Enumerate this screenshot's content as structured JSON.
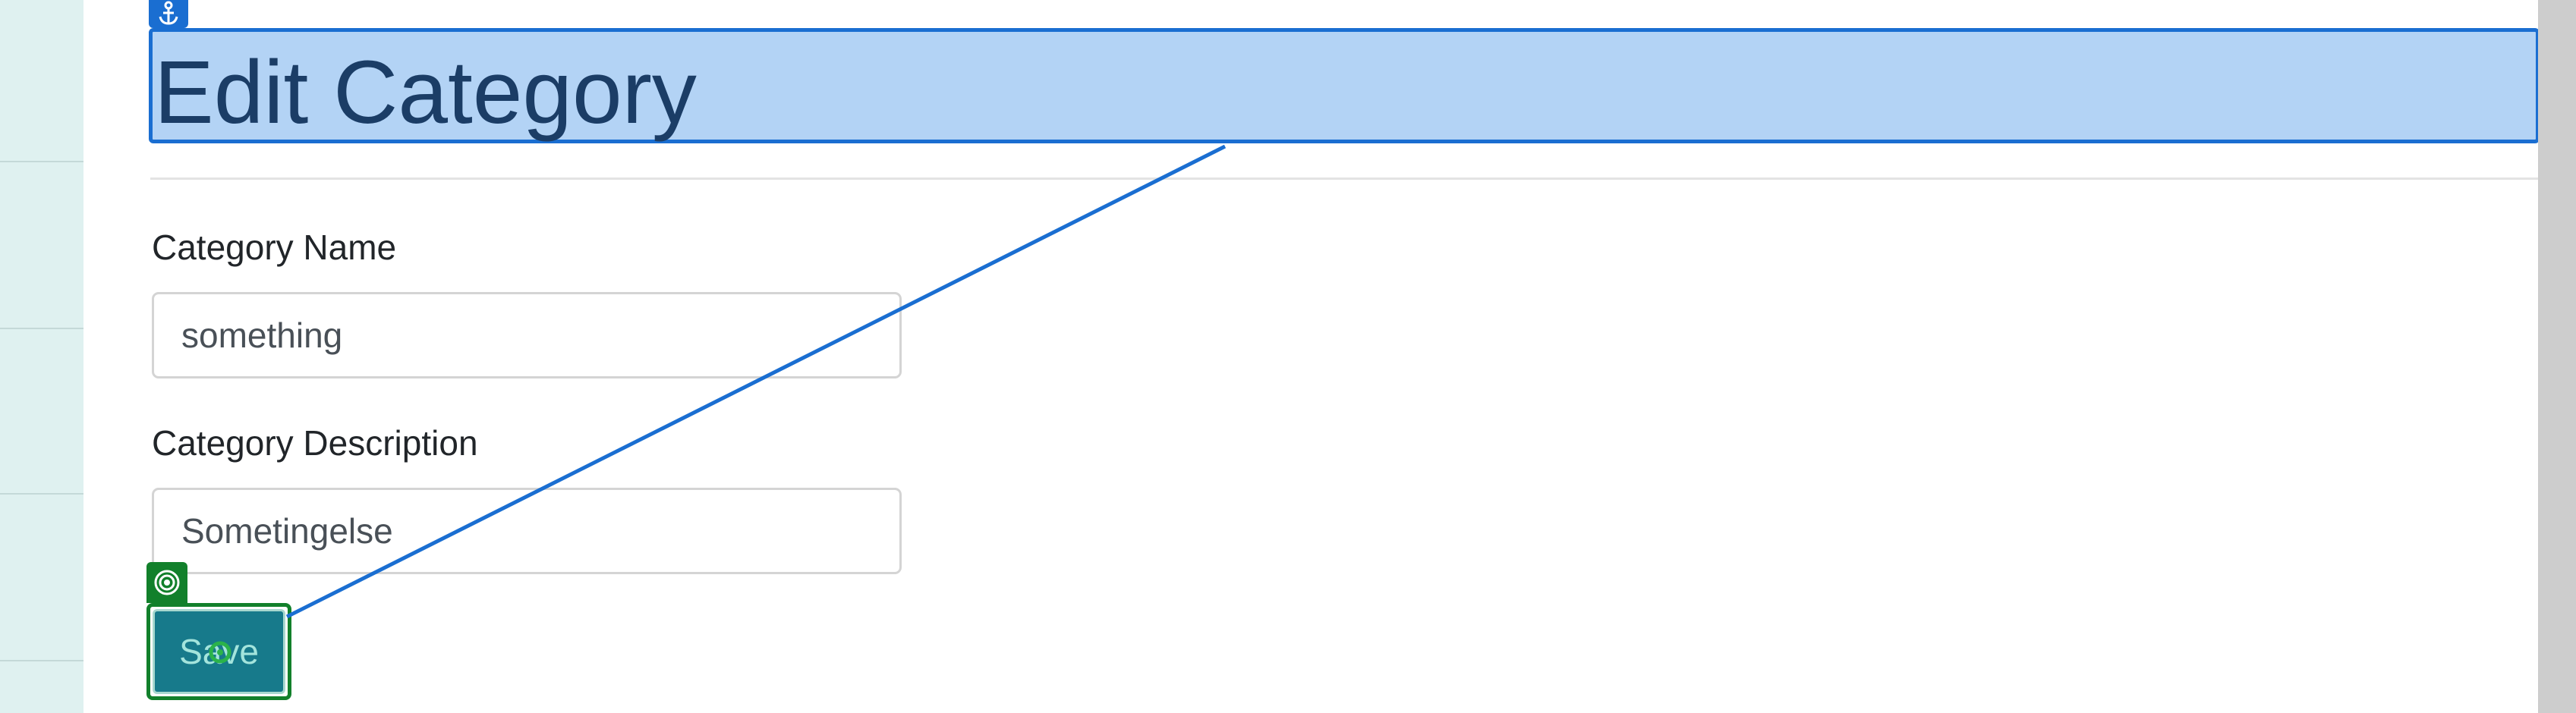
{
  "page": {
    "heading": "Edit Category"
  },
  "form": {
    "name_label": "Category Name",
    "name_value": "something",
    "description_label": "Category Description",
    "description_value": "Sometingelse",
    "save_label": "Save"
  },
  "overlay": {
    "anchor_icon": "anchor-icon",
    "target_icon": "target-icon",
    "cursor_icon": "cursor-icon",
    "link_color": "#1a6ed1",
    "highlight_color": "#b3d3f5",
    "target_color": "#12802b"
  },
  "colors": {
    "sidebar_bg": "#dff1f0",
    "save_button_bg": "#177a8b",
    "heading_text": "#1b3d66"
  }
}
